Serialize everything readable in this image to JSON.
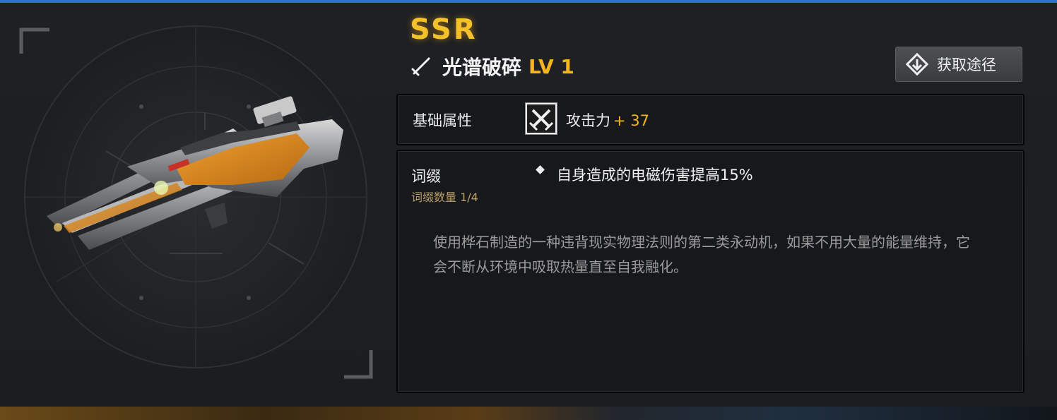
{
  "weapon": {
    "rarity": "SSR",
    "name": "光谱破碎",
    "level": "LV 1",
    "icon": "sword-icon",
    "image": "sniper-rifle-illustration"
  },
  "actions": {
    "source_button_label": "获取途径",
    "source_button_icon": "route-diamond-icon"
  },
  "base_attributes": {
    "label": "基础属性",
    "stat_icon": "crossed-swords-icon",
    "stat_name": "攻击力",
    "stat_bonus": "+ 37"
  },
  "affix": {
    "label": "词缀",
    "count_text": "词缀数量 1/4",
    "entries": [
      "自身造成的电磁伤害提高15%"
    ],
    "lore": "使用桦石制造的一种违背现实物理法则的第二类永动机，如果不用大量的能量维持，它会不断从环境中吸取热量直至自我融化。"
  },
  "colors": {
    "accent_gold": "#f4b521",
    "rarity_gold": "#f5c12b",
    "top_bar_blue": "#2f6fd0",
    "panel_bg": "#1b1d21"
  }
}
